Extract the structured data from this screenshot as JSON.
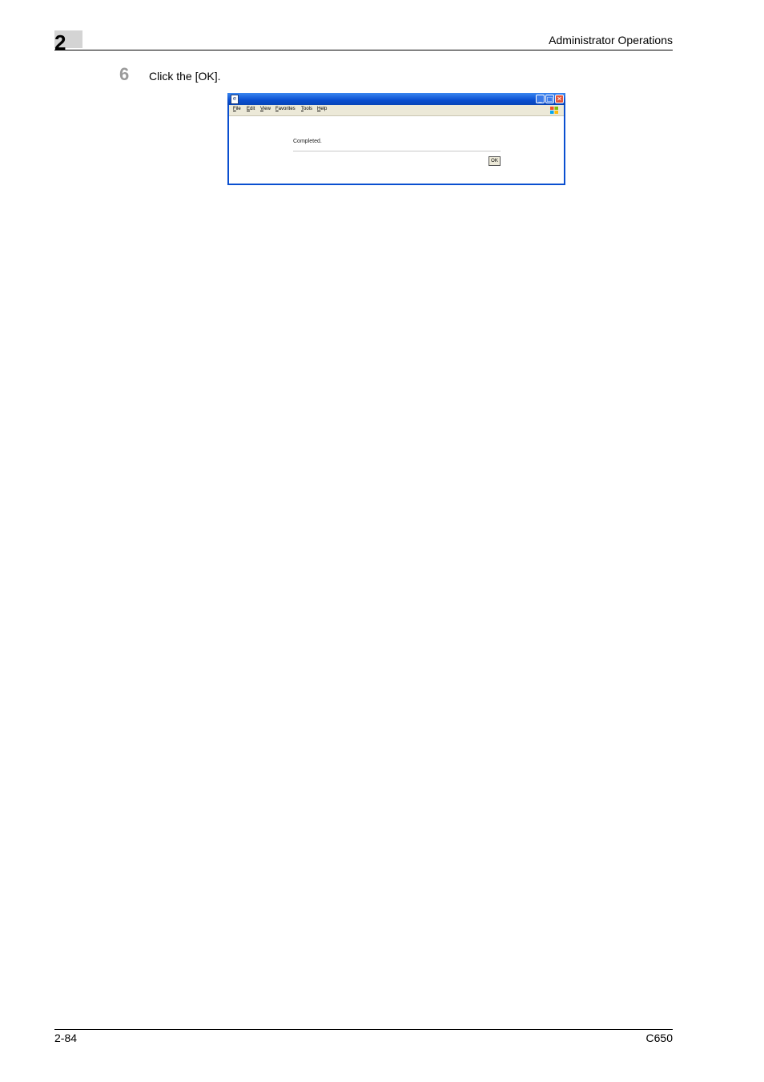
{
  "header": {
    "chapter_number": "2",
    "section_title": "Administrator Operations"
  },
  "step": {
    "number": "6",
    "instruction": "Click the [OK]."
  },
  "browser_window": {
    "menu": [
      "File",
      "Edit",
      "View",
      "Favorites",
      "Tools",
      "Help"
    ],
    "message": "Completed.",
    "ok_label": "OK",
    "icons": [
      "app-icon",
      "minimize-icon",
      "maximize-icon",
      "close-icon",
      "windows-logo-icon"
    ]
  },
  "footer": {
    "page_number": "2-84",
    "model": "C650"
  }
}
